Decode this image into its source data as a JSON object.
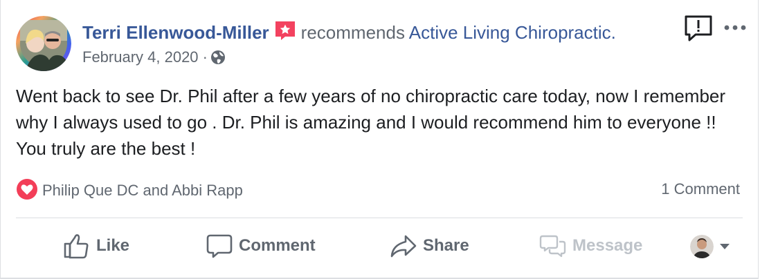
{
  "post": {
    "author_name": "Terri Ellenwood-Miller",
    "recommends_text": "recommends",
    "page_name": "Active Living Chiropractic.",
    "date": "February 4, 2020",
    "meta_separator": "·",
    "privacy_icon": "globe-icon",
    "body": "Went back to see Dr. Phil after a few years of no chiropractic care today, now I remember why I always used to go . Dr. Phil is amazing and I would recommend him to everyone !! You truly are the best !"
  },
  "header_icons": {
    "report": "report-speech-bubble-icon",
    "more": "more-options-icon",
    "recommendation_badge": "recommendation-star-icon"
  },
  "reactions": {
    "icon": "love-reaction-icon",
    "names": "Philip Que DC and Abbi Rapp",
    "comments_count_label": "1 Comment"
  },
  "actions": {
    "like": "Like",
    "comment": "Comment",
    "share": "Share",
    "message": "Message"
  },
  "colors": {
    "link_blue": "#385898",
    "secondary_text": "#606770",
    "love_red": "#f33e58",
    "badge_red": "#f3425f",
    "disabled_text": "#bec3c9"
  }
}
